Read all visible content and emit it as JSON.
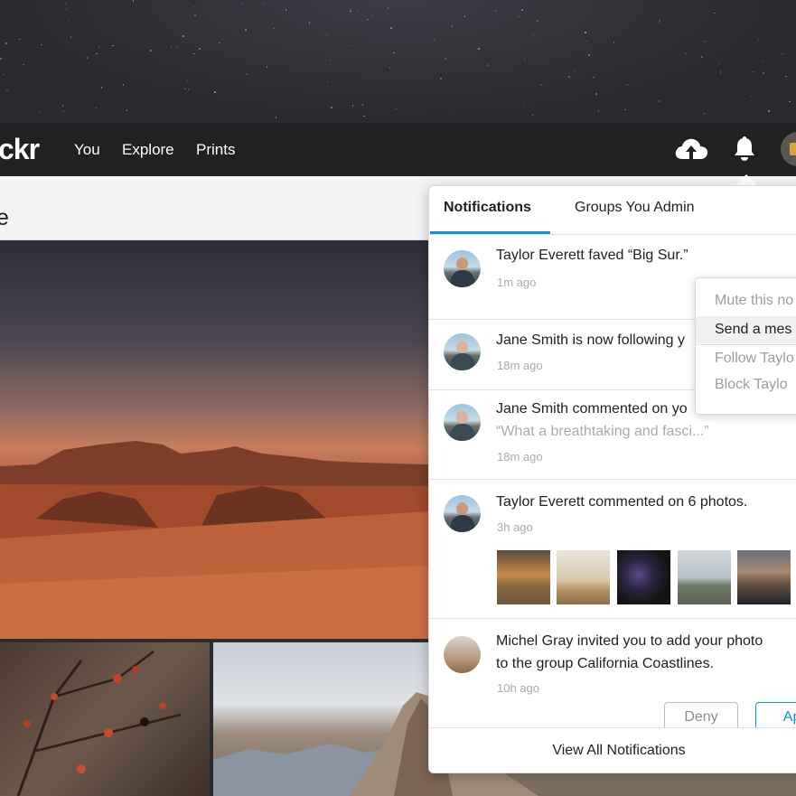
{
  "navbar": {
    "logo": "ckr",
    "links": [
      "You",
      "Explore",
      "Prints"
    ]
  },
  "subhead": {
    "title": "e"
  },
  "notifications": {
    "tabs": [
      "Notifications",
      "Groups You Admin"
    ],
    "items": [
      {
        "text": "Taylor Everett faved “Big Sur.”",
        "time": "1m ago"
      },
      {
        "text": "Jane Smith is now following y",
        "time": "18m ago"
      },
      {
        "text": "Jane Smith commented on yo",
        "quote": "“What a breathtaking and fasci...”",
        "time": "18m ago"
      },
      {
        "text": "Taylor Everett  commented on 6 photos.",
        "time": "3h ago"
      },
      {
        "text_line1": "Michel Gray invited you to add your photo",
        "text_line2": "to the group California Coastlines.",
        "time": "10h ago"
      }
    ],
    "deny_label": "Deny",
    "approve_label": "App",
    "view_all_label": "View All Notifications"
  },
  "context_menu": {
    "items": [
      "Mute this no",
      "Send a mes",
      "Follow Taylo",
      "Block Taylo"
    ]
  },
  "icons": {
    "upload": "cloud-upload-icon",
    "bell": "bell-icon"
  },
  "colors": {
    "navbar": "#212124",
    "accent": "#128fdc"
  }
}
